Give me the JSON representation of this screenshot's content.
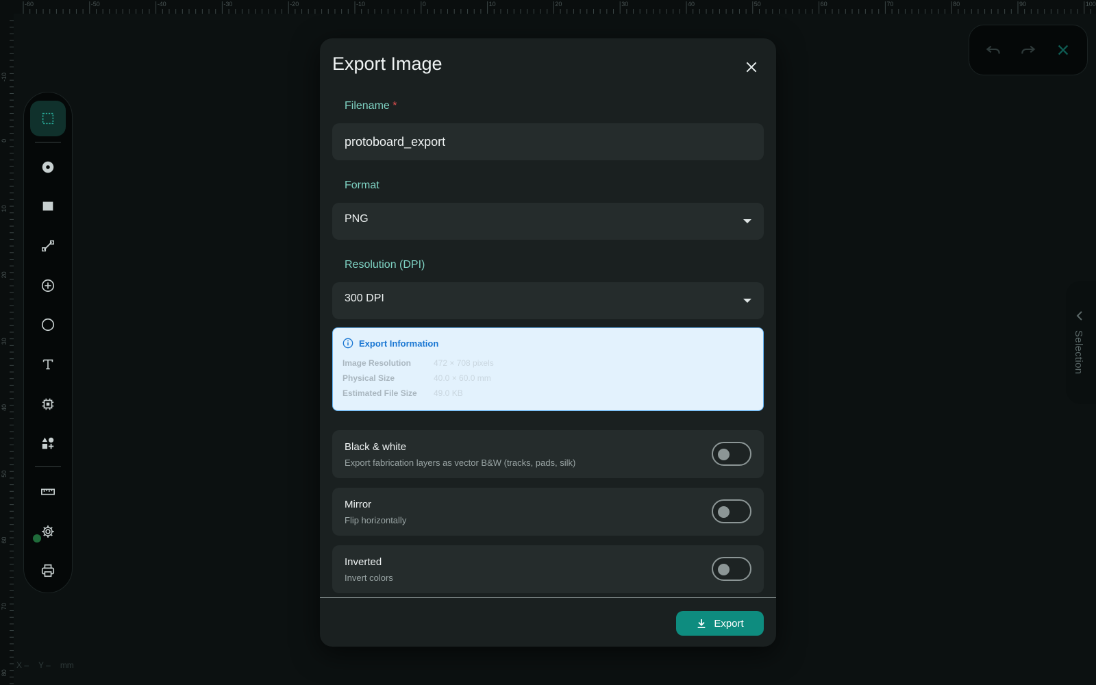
{
  "rulers": {
    "top_labels": [
      "-60",
      "-50",
      "-40",
      "-30",
      "-20",
      "-10",
      "0",
      "10",
      "20",
      "30",
      "40",
      "50",
      "60",
      "70",
      "80",
      "90",
      "100"
    ],
    "left_labels": [
      "-10",
      "0",
      "10",
      "20",
      "30",
      "40",
      "50",
      "60",
      "70",
      "80"
    ]
  },
  "toolbar": {
    "items": [
      {
        "icon": "selection-box-icon",
        "active": true
      },
      {
        "icon": "pad-icon"
      },
      {
        "icon": "rectangle-icon"
      },
      {
        "icon": "track-icon"
      },
      {
        "icon": "via-icon"
      },
      {
        "icon": "circle-icon"
      },
      {
        "icon": "text-icon"
      },
      {
        "icon": "chip-icon"
      },
      {
        "icon": "shapes-icon"
      },
      {
        "icon": "ruler-icon"
      },
      {
        "icon": "gear-icon"
      },
      {
        "icon": "printer-icon"
      }
    ]
  },
  "coords": {
    "x": "X –",
    "y": "Y –",
    "unit": "mm"
  },
  "side_panel": {
    "label": "Selection"
  },
  "dialog": {
    "title": "Export Image",
    "filename": {
      "label": "Filename",
      "required_mark": "*",
      "value": "protoboard_export"
    },
    "format": {
      "label": "Format",
      "value": "PNG"
    },
    "resolution": {
      "label": "Resolution (DPI)",
      "value": "300 DPI"
    },
    "info": {
      "title": "Export Information",
      "rows": [
        {
          "key": "Image Resolution",
          "value": "472 × 708 pixels"
        },
        {
          "key": "Physical Size",
          "value": "40.0 × 60.0 mm"
        },
        {
          "key": "Estimated File Size",
          "value": "49.0 KB"
        }
      ]
    },
    "toggles": [
      {
        "title": "Black & white",
        "subtitle": "Export fabrication layers as vector B&W (tracks, pads, silk)",
        "on": false
      },
      {
        "title": "Mirror",
        "subtitle": "Flip horizontally",
        "on": false
      },
      {
        "title": "Inverted",
        "subtitle": "Invert colors",
        "on": false
      }
    ],
    "export_label": "Export"
  },
  "colors": {
    "accent": "#0e8c7f",
    "label": "#7fd3c4",
    "info_bg": "#e3f2fd",
    "info_text": "#1976d2"
  }
}
